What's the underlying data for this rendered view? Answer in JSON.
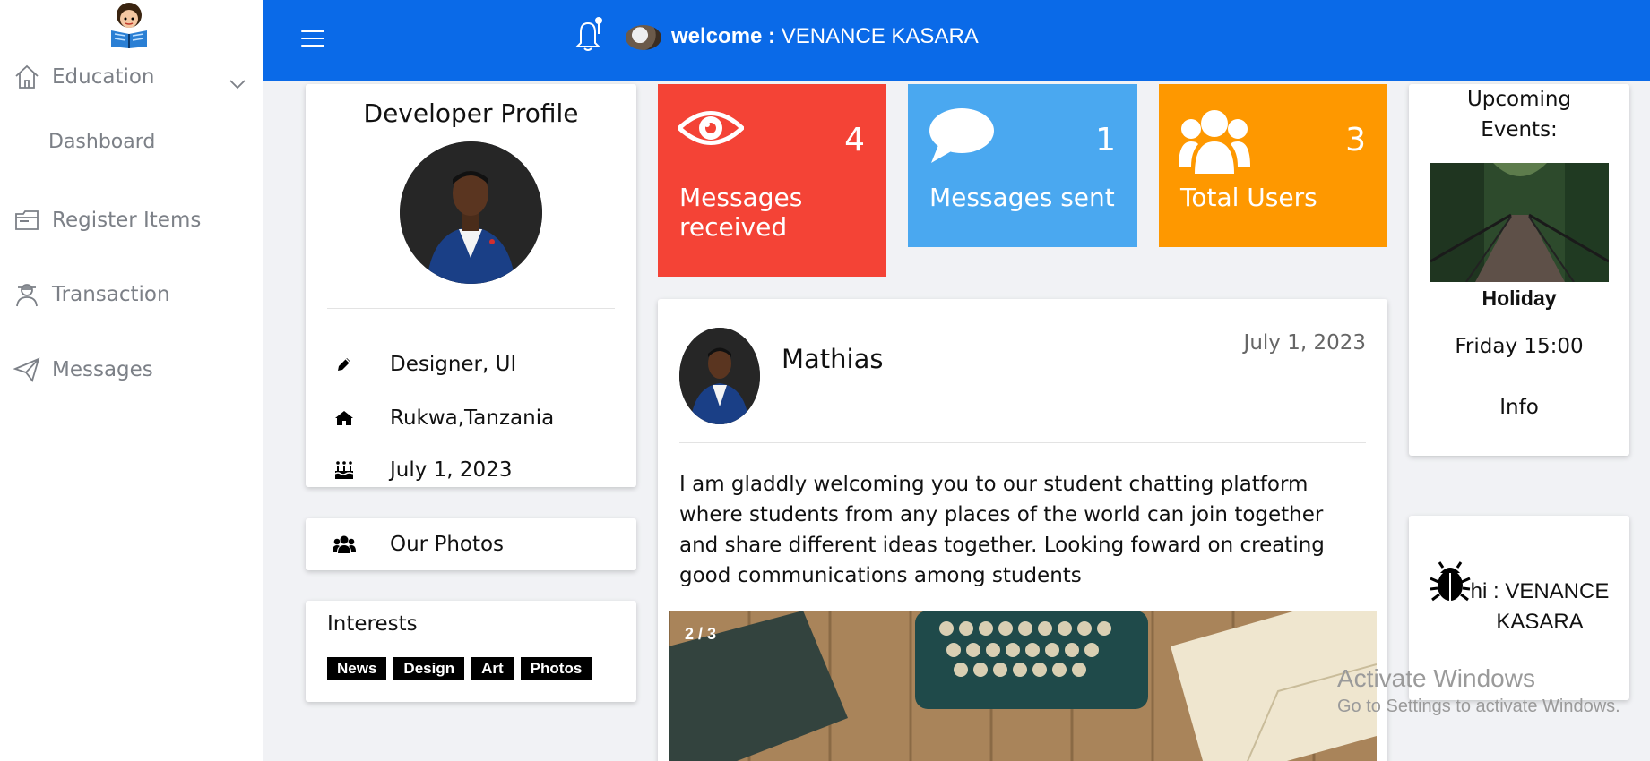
{
  "header": {
    "welcome_prefix": "welcome :",
    "user_name": "VENANCE KASARA"
  },
  "sidebar": {
    "items": [
      {
        "label": "Education",
        "icon": "home-icon"
      },
      {
        "label": "Dashboard"
      },
      {
        "label": "Register Items",
        "icon": "folder-icon"
      },
      {
        "label": "Transaction",
        "icon": "user-icon"
      },
      {
        "label": "Messages",
        "icon": "paper-plane-icon"
      }
    ]
  },
  "profile": {
    "title": "Developer Profile",
    "role": "Designer, UI",
    "location": "Rukwa,Tanzania",
    "birthday": "July 1, 2023"
  },
  "photos": {
    "label": "Our Photos"
  },
  "interests": {
    "title": "Interests",
    "tags": [
      "News",
      "Design",
      "Art",
      "Photos"
    ]
  },
  "stats": [
    {
      "label": "Messages received",
      "value": "4",
      "color": "#f44336",
      "icon": "eye-icon"
    },
    {
      "label": "Messages sent",
      "value": "1",
      "color": "#4aa8f0",
      "icon": "chat-icon"
    },
    {
      "label": "Total Users",
      "value": "3",
      "color": "#fe9800",
      "icon": "users-icon"
    }
  ],
  "post": {
    "author": "Mathias",
    "date": "July 1, 2023",
    "text": "I am gladdly welcoming you to our student chatting platform where students from any places of the world can join together and share different ideas together. Looking foward on creating good communications among students",
    "slide_counter": "2 / 3"
  },
  "events": {
    "title": "Upcoming Events:",
    "name": "Holiday",
    "time": "Friday 15:00",
    "info": "Info"
  },
  "greeting": {
    "prefix": "hi :",
    "name": "VENANCE KASARA"
  },
  "watermark": {
    "line1": "Activate Windows",
    "line2": "Go to Settings to activate Windows."
  },
  "colors": {
    "header": "#0a6ae8",
    "accent_red": "#f44336",
    "accent_blue": "#4aa8f0",
    "accent_orange": "#fe9800"
  }
}
